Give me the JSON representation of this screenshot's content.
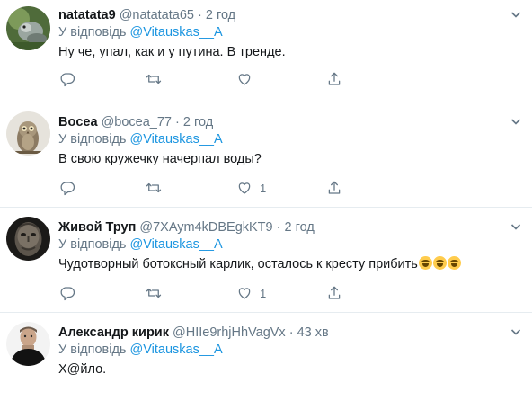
{
  "colors": {
    "accent": "#1b95e0",
    "muted": "#657786",
    "text": "#14171a",
    "divider": "#e6ecf0"
  },
  "tweets": [
    {
      "name": "natatata9",
      "handle": "@natatata65",
      "dot": "·",
      "time": "2 год",
      "reply_prefix": "У відповідь",
      "reply_to": "@Vitauskas__A",
      "text": "Ну че, упал, как и у путина. В тренде.",
      "likes": ""
    },
    {
      "name": "Bocea",
      "handle": "@bocea_77",
      "dot": "·",
      "time": "2 год",
      "reply_prefix": "У відповідь",
      "reply_to": "@Vitauskas__A",
      "text": "В свою кружечку начерпал воды?",
      "likes": "1"
    },
    {
      "name": "Живой Труп",
      "handle": "@7XAym4kDBEgkKT9",
      "dot": "·",
      "time": "2 год",
      "reply_prefix": "У відповідь",
      "reply_to": "@Vitauskas__A",
      "text": "Чудотворный ботоксный карлик, осталось к кресту прибить",
      "emoji_count": 3,
      "emoji_icon": "face-with-tears-of-joy-icon",
      "likes": "1"
    },
    {
      "name": "Александр кирик",
      "handle": "@HIIe9rhjHhVagVx",
      "dot": "·",
      "time": "43 хв",
      "reply_prefix": "У відповідь",
      "reply_to": "@Vitauskas__A",
      "text": "Х@йло.",
      "likes": ""
    }
  ],
  "icons": {
    "reply": "reply-icon",
    "retweet": "retweet-icon",
    "like": "heart-icon",
    "share": "share-icon",
    "menu": "chevron-down-icon"
  }
}
